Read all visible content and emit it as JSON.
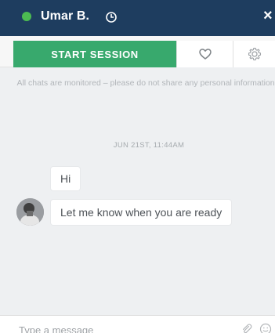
{
  "header": {
    "name": "Umar B.",
    "colors": {
      "background": "#1e3d5f",
      "status_online": "#4cbb52"
    },
    "icons": [
      "status-dot-icon",
      "clock-icon",
      "close-icon"
    ]
  },
  "toolbar": {
    "start_session_label": "START SESSION",
    "start_session_color": "#38a96d",
    "icons": [
      "heart-icon",
      "gear-icon"
    ]
  },
  "chat": {
    "notice": "All chats are monitored – please do not share any personal information.",
    "timestamp": "JUN 21ST, 11:44AM",
    "messages": [
      {
        "text": "Hi"
      },
      {
        "text": "Let me know when you are ready"
      }
    ]
  },
  "composer": {
    "placeholder": "Type a message",
    "icons": [
      "paperclip-icon",
      "emoji-icon"
    ]
  }
}
